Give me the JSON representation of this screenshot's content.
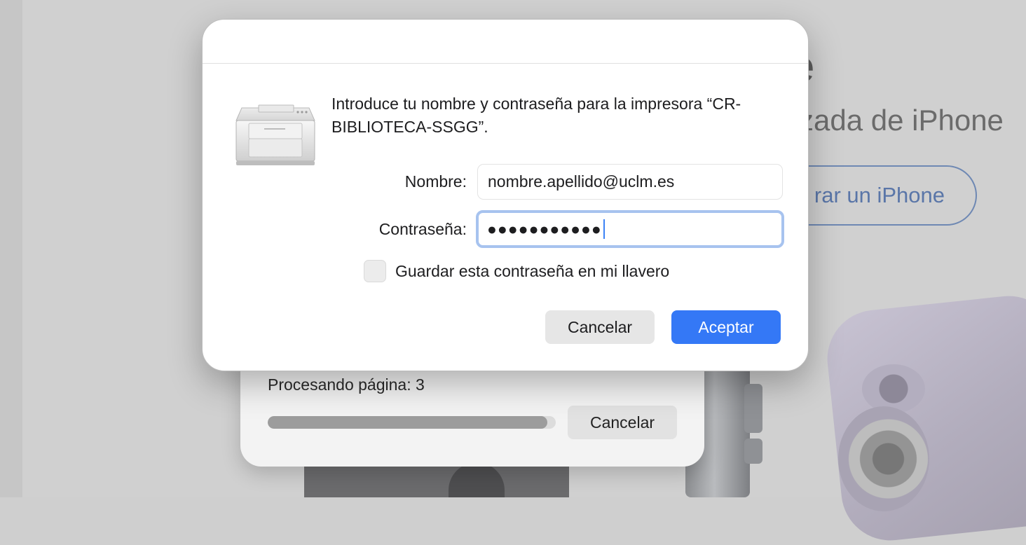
{
  "background": {
    "title_fragment": "e",
    "subtitle_fragment": "zada de iPhone",
    "link_button": "rar un iPhone"
  },
  "progress_sheet": {
    "status": "Procesando página: 3",
    "progress_fraction": 0.97,
    "cancel_label": "Cancelar"
  },
  "auth_dialog": {
    "icon": "printer-icon",
    "message": "Introduce tu nombre y contraseña para la impresora “CR-BIBLIOTECA-SSGG”.",
    "name_label": "Nombre:",
    "name_value": "nombre.apellido@uclm.es",
    "password_label": "Contraseña:",
    "password_mask": "●●●●●●●●●●●",
    "remember_label": "Guardar esta contraseña en mi llavero",
    "remember_checked": false,
    "cancel_label": "Cancelar",
    "ok_label": "Aceptar"
  },
  "colors": {
    "accent": "#3478f6",
    "focus_ring": "#a7c3ef"
  }
}
